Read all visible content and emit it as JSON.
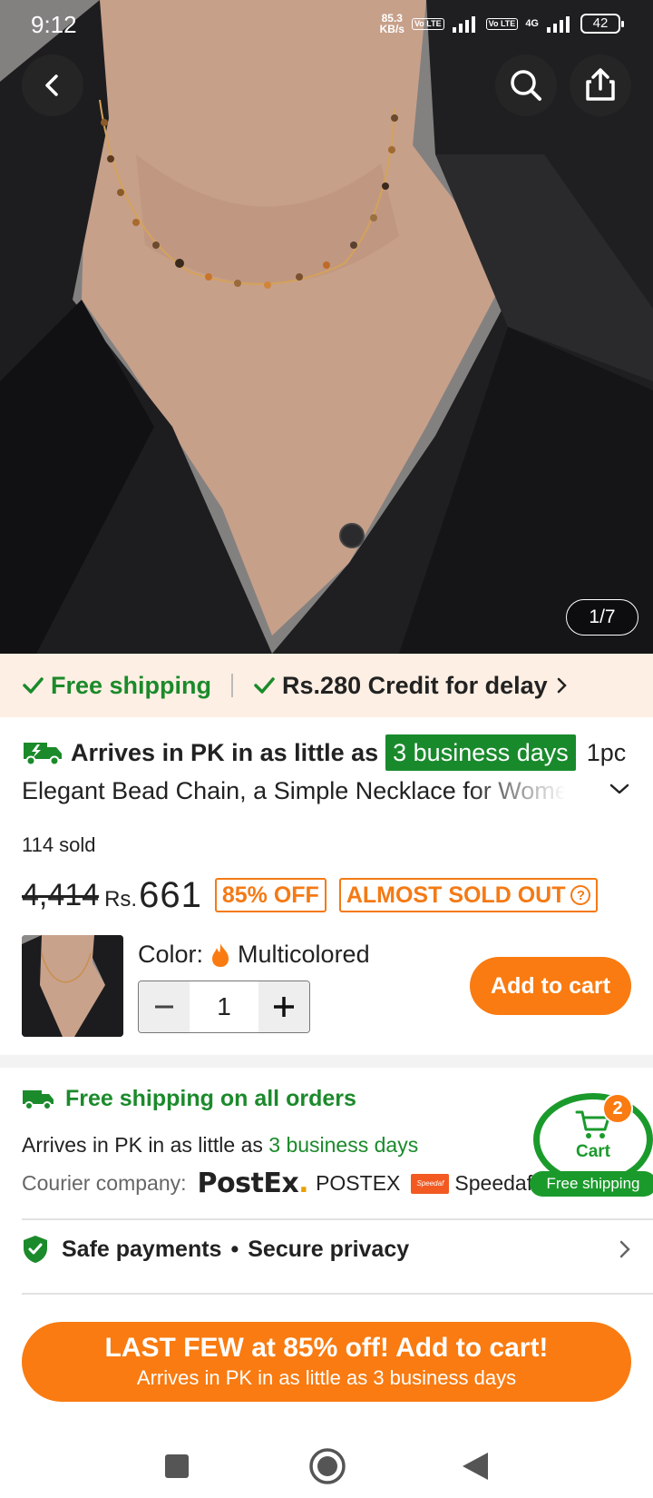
{
  "status_bar": {
    "time": "9:12",
    "net_speed_value": "85.3",
    "net_speed_unit": "KB/s",
    "volte": "Vo LTE",
    "network": "4G",
    "battery": "42"
  },
  "hero": {
    "image_counter": "1/7"
  },
  "banner": {
    "free_shipping": "Free shipping",
    "credit": "Rs.280 Credit for delay"
  },
  "product": {
    "arrives_prefix": "Arrives in PK in as little as",
    "arrives_days": "3 business days",
    "title_start": "1pc",
    "title_line2": "Elegant Bead Chain, a Simple Necklace for Women",
    "sold": "114 sold",
    "original_price": "4,414",
    "currency": "Rs.",
    "price": "661",
    "discount_badge": "85% OFF",
    "stock_badge": "ALMOST SOLD OUT",
    "color_label": "Color:",
    "color_value": "Multicolored",
    "quantity": "1",
    "add_to_cart": "Add to cart"
  },
  "shipping": {
    "title": "Free shipping on all orders",
    "arrive_prefix": "Arrives in PK in as little as",
    "arrive_days": "3 business days",
    "courier_label": "Courier company:",
    "postex_logo_main": "PostEx",
    "postex_logo_dot": ".",
    "courier_1": "POSTEX",
    "speedaf_logo": "Speedaf",
    "courier_2": "Speedaf ..."
  },
  "cart_float": {
    "label": "Cart",
    "count": "2",
    "pill": "Free shipping"
  },
  "safety": {
    "payments": "Safe payments",
    "dot": "•",
    "privacy": "Secure privacy"
  },
  "cta": {
    "main": "LAST FEW at 85% off! Add to cart!",
    "sub": "Arrives in PK in as little as 3 business days"
  },
  "colors": {
    "accent_orange": "#f97b11",
    "green": "#1b8a2b",
    "banner_bg": "#fdefe3"
  }
}
